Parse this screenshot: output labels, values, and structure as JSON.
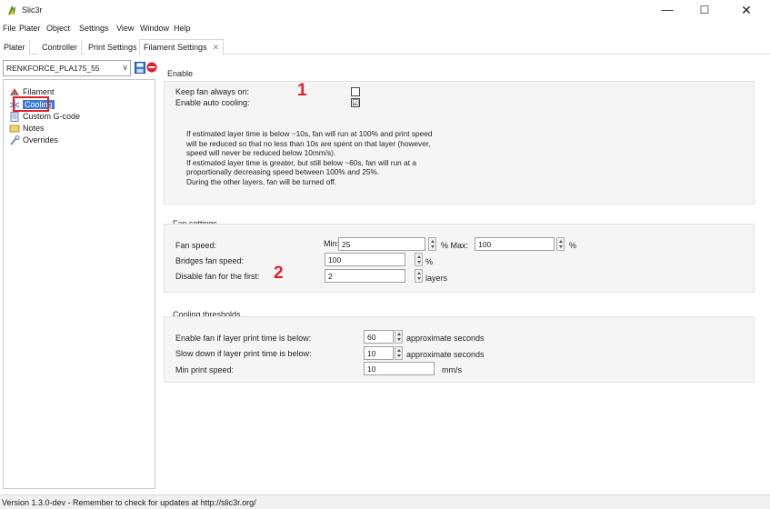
{
  "window": {
    "title": "Slic3r",
    "minimize": "—",
    "maximize": "☐",
    "close": "✕"
  },
  "menu": [
    "File",
    "Plater",
    "Object",
    "Settings",
    "View",
    "Window",
    "Help"
  ],
  "tabs": [
    {
      "label": "Plater"
    },
    {
      "label": "Controller"
    },
    {
      "label": "Print Settings"
    },
    {
      "label": "Filament Settings",
      "close": "✕",
      "active": true
    }
  ],
  "preset": {
    "value": "RENKFORCE_PLA175_55",
    "chevron": "∨"
  },
  "tree": [
    {
      "label": "Filament",
      "icon": "spool-icon"
    },
    {
      "label": "Cooling",
      "icon": "snowflake-icon",
      "selected": true
    },
    {
      "label": "Custom G-code",
      "icon": "document-icon"
    },
    {
      "label": "Notes",
      "icon": "note-icon"
    },
    {
      "label": "Overrides",
      "icon": "wrench-icon"
    }
  ],
  "enable": {
    "title": "Enable",
    "keep_fan_label": "Keep fan always on:",
    "keep_fan_checked": false,
    "auto_cooling_label": "Enable auto cooling:",
    "auto_cooling_checked": true,
    "auto_cooling_mark": "☑",
    "description": [
      "If estimated layer time is below ~10s, fan will run at 100% and print speed",
      "will be reduced so that no less than 10s are spent on that layer (however,",
      "speed will never be reduced below 10mm/s).",
      "If estimated layer time is greater, but still below ~60s, fan will run at a",
      "proportionally decreasing speed between 100% and 25%.",
      "During the other layers, fan will be turned off."
    ]
  },
  "fan_settings": {
    "title": "Fan settings",
    "fan_speed_label": "Fan speed:",
    "min_label": "Min:",
    "min_value": "25",
    "pct_label_1": "% Max:",
    "max_value": "100",
    "pct_label_2": "%",
    "bridges_label": "Bridges fan speed:",
    "bridges_value": "100",
    "bridges_unit": "%",
    "disable_label": "Disable fan for the first:",
    "disable_value": "2",
    "disable_unit": "layers"
  },
  "cooling_thresholds": {
    "title": "Cooling thresholds",
    "enable_below_label": "Enable fan if layer print time is below:",
    "enable_below_value": "60",
    "enable_below_unit": "approximate seconds",
    "slowdown_label": "Slow down if layer print time is below:",
    "slowdown_value": "10",
    "slowdown_unit": "approximate seconds",
    "min_speed_label": "Min print speed:",
    "min_speed_value": "10",
    "min_speed_unit": "mm/s"
  },
  "annotations": {
    "one": "1",
    "two": "2"
  },
  "status": {
    "text": "Version 1.3.0-dev - Remember to check for updates at http://slic3r.org/"
  },
  "colors": {
    "annotation_red": "#e2202a",
    "selection_blue": "#3a7bd5",
    "group_bg": "#f5f5f5"
  }
}
